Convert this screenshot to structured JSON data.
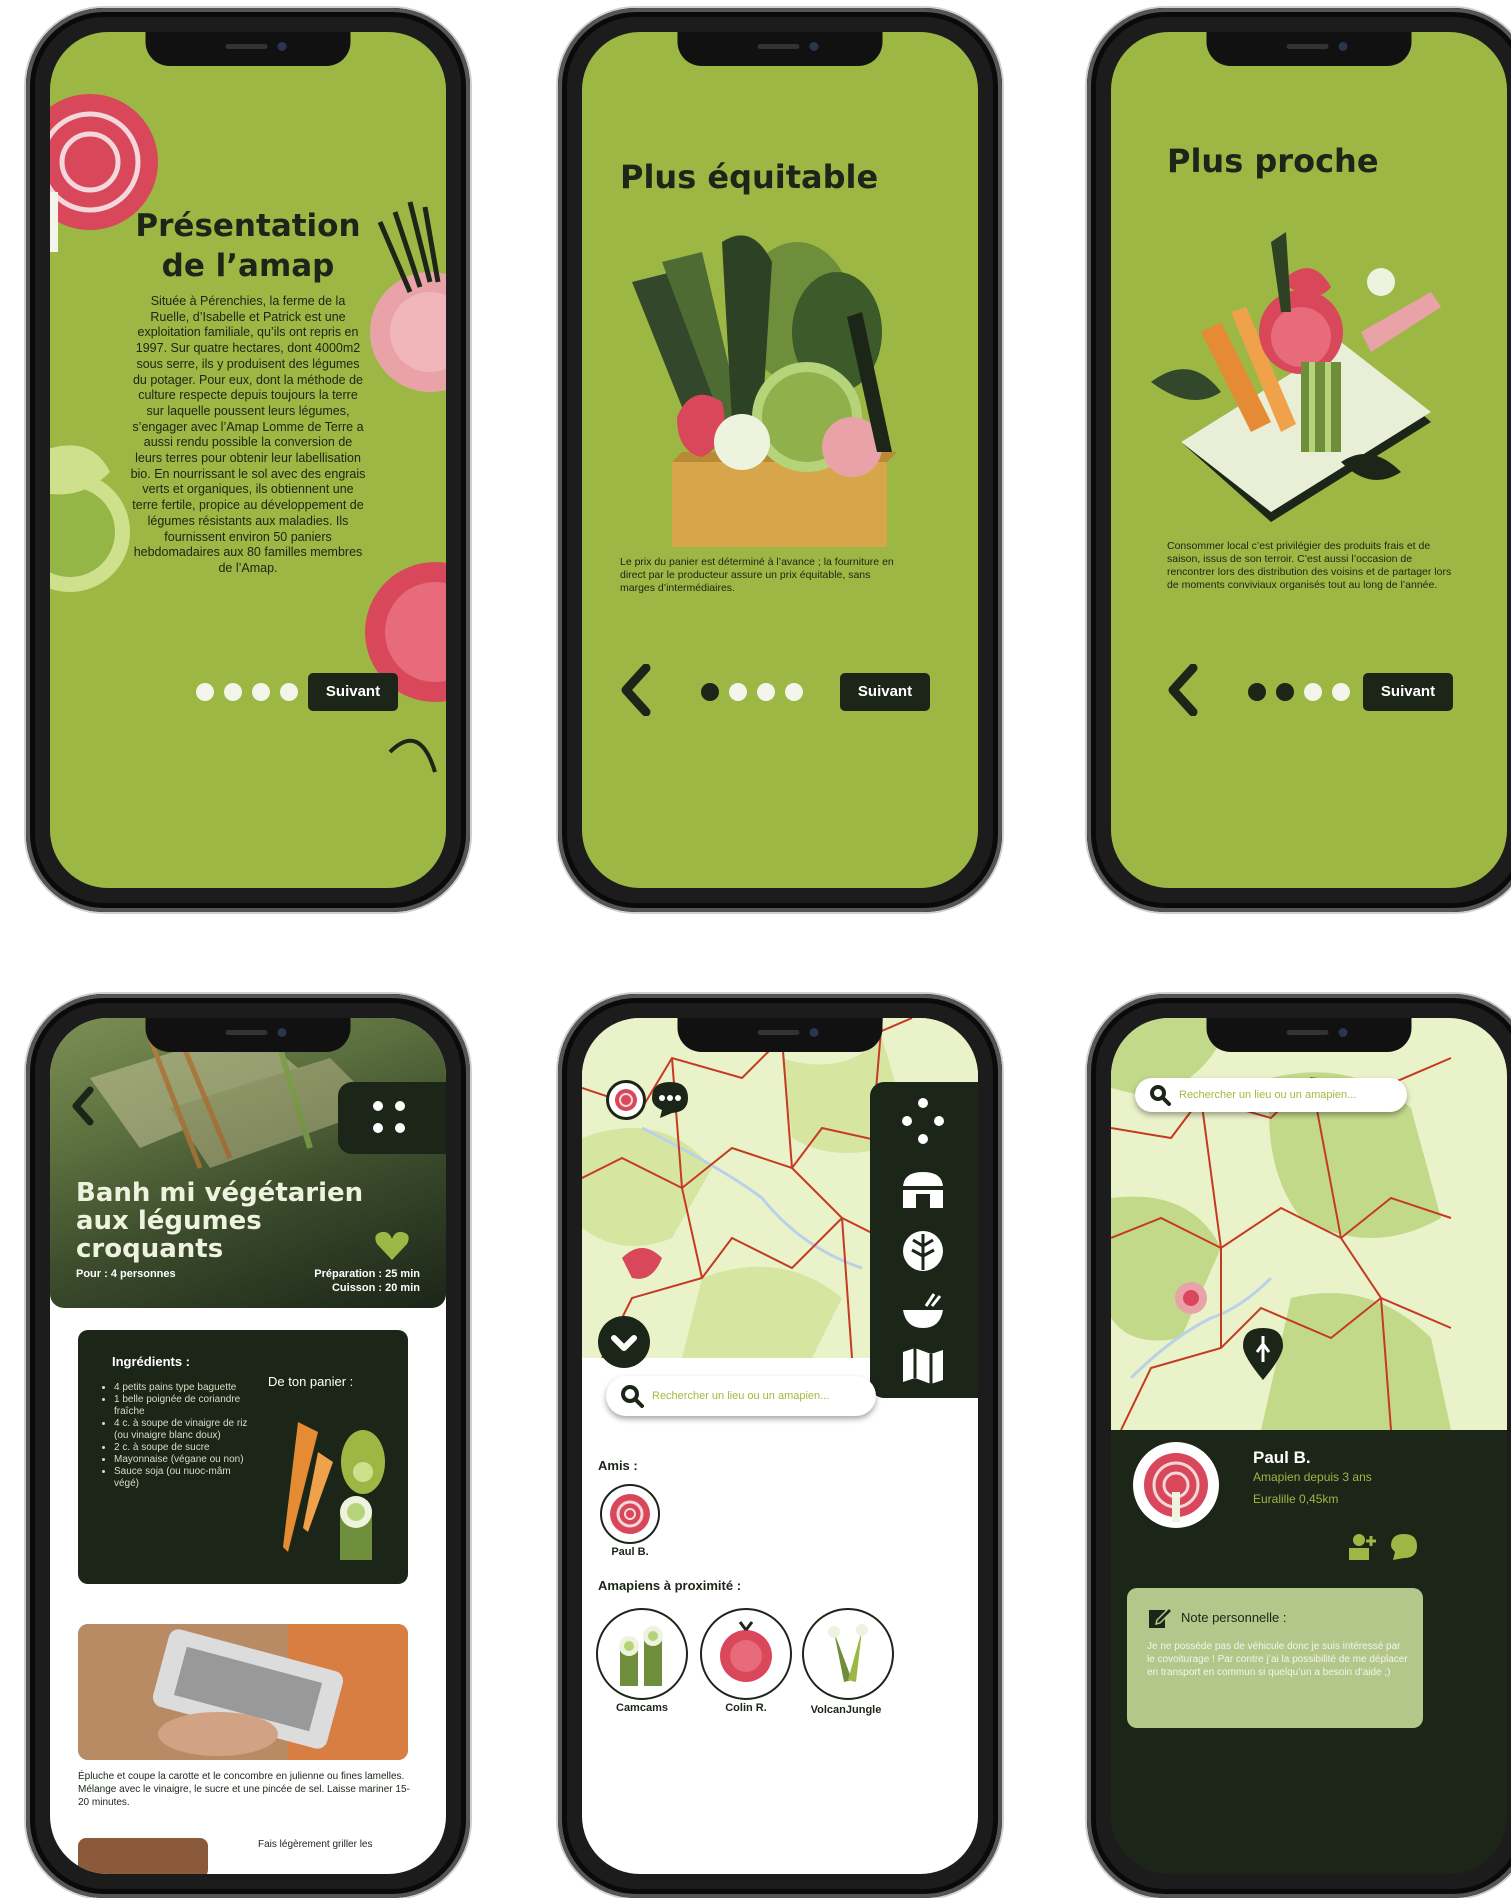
{
  "colors": {
    "accent": "#9cb744",
    "dark": "#1b2518",
    "map_bg": "#eaf2c9",
    "map_green": "#c3d98a",
    "road": "#c53a23",
    "beet": "#d9475a"
  },
  "common": {
    "next_label": "Suivant"
  },
  "onboarding1": {
    "title_line1": "Présentation",
    "title_line2": "de l’amap",
    "body": "Située à Pérenchies, la ferme de la Ruelle, d’Isabelle et Patrick est une exploitation familiale, qu’ils ont repris en 1997. Sur quatre hectares, dont 4000m2 sous serre, ils y produisent des légumes du potager. Pour eux, dont la méthode de culture respecte depuis toujours la terre sur laquelle poussent leurs légumes, s’engager avec l’Amap Lomme de Terre a aussi rendu possible la conversion de leurs terres pour obtenir leur labellisation bio. En nourrissant le sol avec des engrais verts et organiques, ils obtiennent une terre fertile, propice au développement de légumes résistants aux maladies. Ils fournissent environ 50 paniers hebdomadaires aux 80 familles membres de l’Amap."
  },
  "onboarding2": {
    "title": "Plus équitable",
    "body": "Le prix du panier est déterminé à l’avance ; la fourniture en direct par le producteur assure un prix équitable, sans marges d’intermédiaires."
  },
  "onboarding3": {
    "title": "Plus proche",
    "body": "Consommer local c’est privilégier des produits frais et de saison, issus de son terroir. C’est aussi l’occasion de rencontrer lors des distribution des voisins et de partager lors de moments conviviaux organisés tout au long de l’année."
  },
  "recipe": {
    "title_line1": "Banh mi végétarien",
    "title_line2": "aux légumes",
    "title_line3": "croquants",
    "servings": "Pour : 4 personnes",
    "prep": "Préparation : 25 min",
    "cook": "Cuisson : 20 min",
    "ingredients_title": "Ingrédients :",
    "basket_title": "De ton panier :",
    "ingredients": [
      "4 petits pains type baguette",
      "1 belle poignée de coriandre fraîche",
      "4 c. à soupe de vinaigre de riz (ou vinaigre blanc doux)",
      "2 c. à soupe de sucre",
      "Mayonnaise (végane ou non)",
      "Sauce soja (ou nuoc-mâm végé)"
    ],
    "step1": "Épluche et coupe la carotte et le concombre en julienne ou fines lamelles. Mélange avec le vinaigre, le sucre et une pincée de sel. Laisse mariner 15-20 minutes.",
    "step2": "Fais légèrement griller les"
  },
  "map_screen": {
    "search_placeholder": "Rechercher un lieu ou un amapien...",
    "friends_title": "Amis :",
    "friends": [
      {
        "name": "Paul B."
      }
    ],
    "nearby_title": "Amapiens à proximité :",
    "nearby": [
      {
        "name": "Camcams"
      },
      {
        "name": "Colin R."
      },
      {
        "name": "VolcanJungle"
      }
    ],
    "menu_icons": [
      "grid-icon",
      "farm-icon",
      "leaf-icon",
      "bowl-icon",
      "map-icon"
    ]
  },
  "profile": {
    "search_placeholder": "Rechercher un lieu ou un amapien...",
    "name": "Paul B.",
    "since": "Amapien depuis 3 ans",
    "location": "Euralille 0,45km",
    "note_title": "Note personnelle :",
    "note_body": "Je ne possède pas de véhicule donc je suis intéressé par le covoiturage ! Par contre j’ai la possibilité de me déplacer en transport en commun si quelqu’un a besoin d’aide ;)"
  }
}
